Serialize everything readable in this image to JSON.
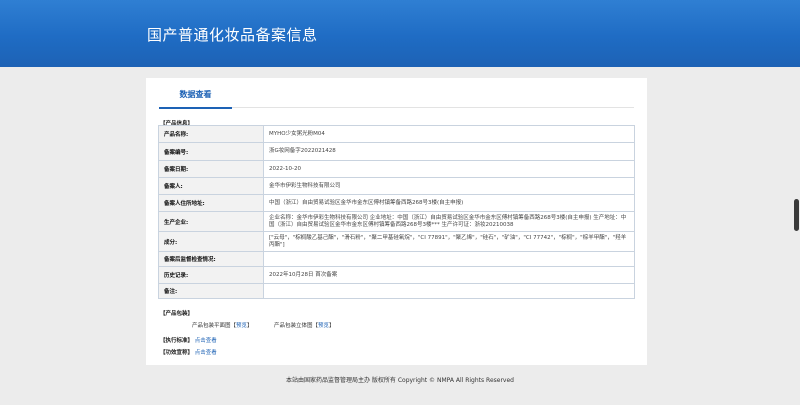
{
  "header": {
    "title": "国产普通化妆品备案信息"
  },
  "tabs": [
    {
      "label": "数据查看"
    }
  ],
  "sections": {
    "product_info": "【产品信息】",
    "product_packaging": "【产品包装】",
    "standard": "【执行标准】",
    "efficacy": "【功效宣称】"
  },
  "info_rows": [
    {
      "label": "产品名称:",
      "value": "MYHO少女粥光粉M04"
    },
    {
      "label": "备案编号:",
      "value": "浙G妆网备字2022021428"
    },
    {
      "label": "备案日期:",
      "value": "2022-10-20"
    },
    {
      "label": "备案人:",
      "value": "金华市伊彩生物科技有限公司"
    },
    {
      "label": "备案人住所地址:",
      "value": "中国（浙江）自由贸易试验区金华市金东区傅村镇筹备西路268号3楼(自主申报)"
    },
    {
      "label": "生产企业:",
      "value": "企业名称：金华市伊彩生物科技有限公司 企业地址：中国（浙江）自由贸易试验区金华市金东区傅村镇筹备西路268号3楼(自主申报) 生产地址：中国（浙江）自由贸易试验区金华市金东区傅村镇筹备西路268号3楼*** 生产许可证：浙妆20210038"
    },
    {
      "label": "成分:",
      "value": "[\"云母\"，\"棕榈酸乙基己酯\"，\"滑石粉\"，\"聚二甲基硅氧烷\"，\"CI 77891\"，\"聚乙烯\"，\"硅石\"，\"矿油\"，\"CI 77742\"，\"棕榈\"，\"棕羊甲酯\"，\"羟羊丙酯\"]"
    },
    {
      "label": "备案后监督检查情况:",
      "value": ""
    },
    {
      "label": "历史记录:",
      "value": "2022年10月28日 首次备案"
    },
    {
      "label": "备注:",
      "value": ""
    }
  ],
  "packaging": {
    "flat_label": "产品包装平面图",
    "flat_link": "预览",
    "stereo_label": "产品包装立体图",
    "stereo_link": "预览",
    "bracket_open": "【",
    "bracket_close": "】"
  },
  "links": {
    "view": "点击查看"
  },
  "footer": {
    "text": "本站由国家药品监督管理局主办 版权所有 Copyright © NMPA All Rights Reserved"
  }
}
